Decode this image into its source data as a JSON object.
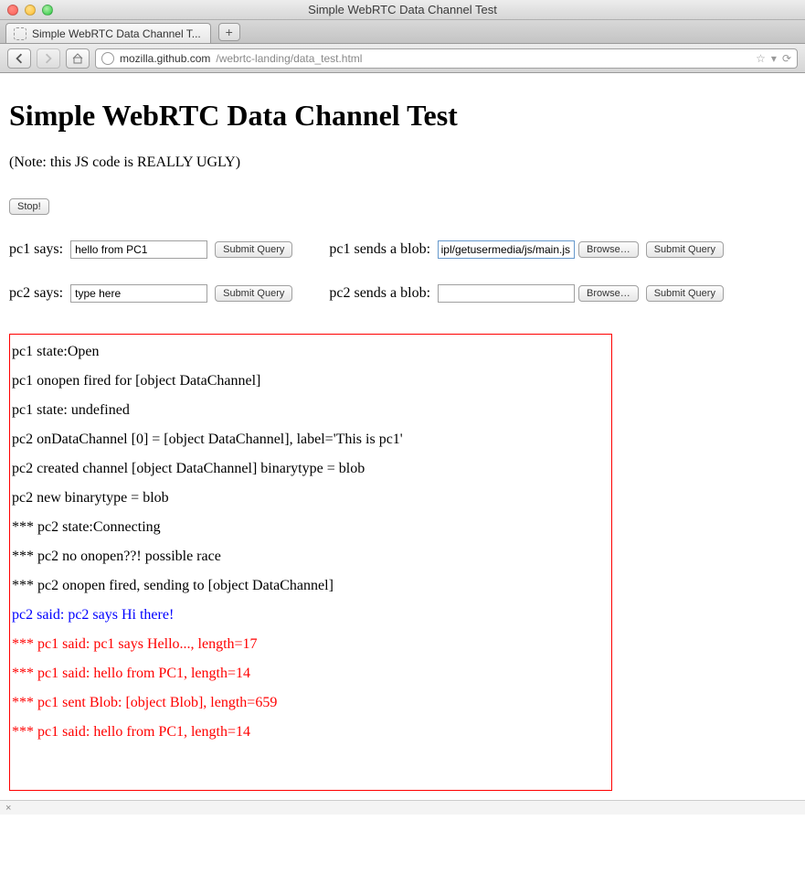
{
  "window": {
    "title": "Simple WebRTC Data Channel Test"
  },
  "tab": {
    "label": "Simple WebRTC Data Channel T..."
  },
  "url": {
    "host": "mozilla.github.com",
    "path": "/webrtc-landing/data_test.html"
  },
  "page": {
    "heading": "Simple WebRTC Data Channel Test",
    "note": "(Note: this JS code is REALLY UGLY)",
    "stop_label": "Stop!",
    "submit_label": "Submit Query",
    "browse_label": "Browse…",
    "pc1_says_label": "pc1 says:",
    "pc1_says_value": "hello from PC1",
    "pc2_says_label": "pc2 says:",
    "pc2_says_value": "type here",
    "pc1_blob_label": "pc1 sends a blob:",
    "pc1_blob_value": "ipl/getusermedia/js/main.js",
    "pc2_blob_label": "pc2 sends a blob:",
    "pc2_blob_value": ""
  },
  "log": [
    {
      "text": "pc1 state:Open",
      "color": "black"
    },
    {
      "text": "pc1 onopen fired for [object DataChannel]",
      "color": "black"
    },
    {
      "text": "pc1 state: undefined",
      "color": "black"
    },
    {
      "text": "pc2 onDataChannel [0] = [object DataChannel], label='This is pc1'",
      "color": "black"
    },
    {
      "text": "pc2 created channel [object DataChannel] binarytype = blob",
      "color": "black"
    },
    {
      "text": "pc2 new binarytype = blob",
      "color": "black"
    },
    {
      "text": "*** pc2 state:Connecting",
      "color": "black"
    },
    {
      "text": "*** pc2 no onopen??! possible race",
      "color": "black"
    },
    {
      "text": "*** pc2 onopen fired, sending to [object DataChannel]",
      "color": "black"
    },
    {
      "text": "pc2 said: pc2 says Hi there!",
      "color": "blue"
    },
    {
      "text": "*** pc1 said: pc1 says Hello..., length=17",
      "color": "red"
    },
    {
      "text": "*** pc1 said: hello from PC1, length=14",
      "color": "red"
    },
    {
      "text": "*** pc1 sent Blob: [object Blob], length=659",
      "color": "red"
    },
    {
      "text": "*** pc1 said: hello from PC1, length=14",
      "color": "red"
    }
  ],
  "statusbar": {
    "text": "×"
  }
}
